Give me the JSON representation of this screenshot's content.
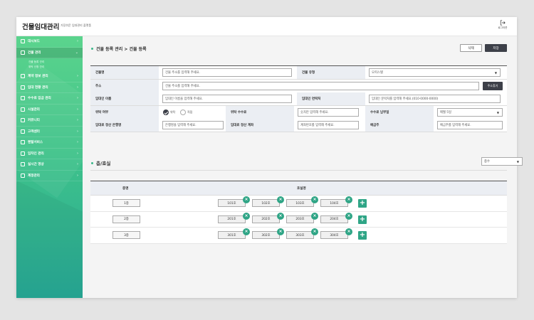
{
  "app": {
    "title": "건물임대관리",
    "subtitle": "가장쉬운 임대관리 플랫폼",
    "logout_label": "로그아웃"
  },
  "sidebar": {
    "items": [
      {
        "label": "대시보드",
        "icon": "dashboard-icon"
      },
      {
        "label": "건물 관리",
        "icon": "building-icon",
        "active": true,
        "children": [
          "건물 등록 관리",
          "위탁 신청 관리"
        ]
      },
      {
        "label": "계약 정보 관리",
        "icon": "contract-icon"
      },
      {
        "label": "임대 현황 관리",
        "icon": "key-icon"
      },
      {
        "label": "수수료 입금 관리",
        "icon": "money-icon"
      },
      {
        "label": "시설관리",
        "icon": "tools-icon"
      },
      {
        "label": "커뮤니티",
        "icon": "chat-icon"
      },
      {
        "label": "고객센터",
        "icon": "support-icon"
      },
      {
        "label": "렌탈서비스",
        "icon": "rental-icon"
      },
      {
        "label": "임차인 관리",
        "icon": "tenant-icon"
      },
      {
        "label": "실시간 영상",
        "icon": "video-icon"
      },
      {
        "label": "계정관리",
        "icon": "account-icon"
      }
    ]
  },
  "main": {
    "breadcrumb": "건물 등록 관리 > 건물 등록",
    "delete_label": "삭제",
    "save_label": "저장"
  },
  "form": {
    "building_name": {
      "label": "건물명",
      "placeholder": "건물 주소를 입력해 주세요."
    },
    "building_type": {
      "label": "건물 유형",
      "value": "오피스텔"
    },
    "address": {
      "label": "주소",
      "placeholder": "건물 주소를 입력해 주세요.",
      "button": "주소찾기"
    },
    "landlord_name": {
      "label": "임대인 이름",
      "placeholder": "임대인 이름을 입력해 주세요."
    },
    "landlord_contact": {
      "label": "임대인 연락처",
      "placeholder": "임대인 문락처를 입력해 주세요.(010-0000-0000)"
    },
    "consign": {
      "label": "위탁 여부",
      "option_yes": "위탁",
      "option_no": "직접",
      "selected": "위탁"
    },
    "consign_fee": {
      "label": "위탁 수수료",
      "placeholder": "숫자만 입력해 주세요."
    },
    "fee_date": {
      "label": "수수료 납부일",
      "value": "매월 5일"
    },
    "bank": {
      "label": "임대료 정산 은행명",
      "placeholder": "은행명을 입력해 주세요."
    },
    "account": {
      "label": "임대료 정산 계좌",
      "placeholder": "계좌번호를 입력해 주세요."
    },
    "holder": {
      "label": "예금주",
      "placeholder": "예금주를 입력해 주세요."
    }
  },
  "floors": {
    "title": "층/호실",
    "select_value": "층수",
    "col_floor": "층명",
    "col_room": "호실명",
    "rows": [
      {
        "floor": "1층",
        "rooms": [
          "101호",
          "102호",
          "103호",
          "104호"
        ]
      },
      {
        "floor": "2층",
        "rooms": [
          "201호",
          "202호",
          "203호",
          "204호"
        ]
      },
      {
        "floor": "3층",
        "rooms": [
          "301호",
          "302호",
          "303호",
          "304호"
        ]
      }
    ]
  },
  "colors": {
    "accent": "#3ab88a",
    "dark": "#3d4049",
    "sidebar_top": "#5bd48d",
    "sidebar_bottom": "#27a996"
  }
}
